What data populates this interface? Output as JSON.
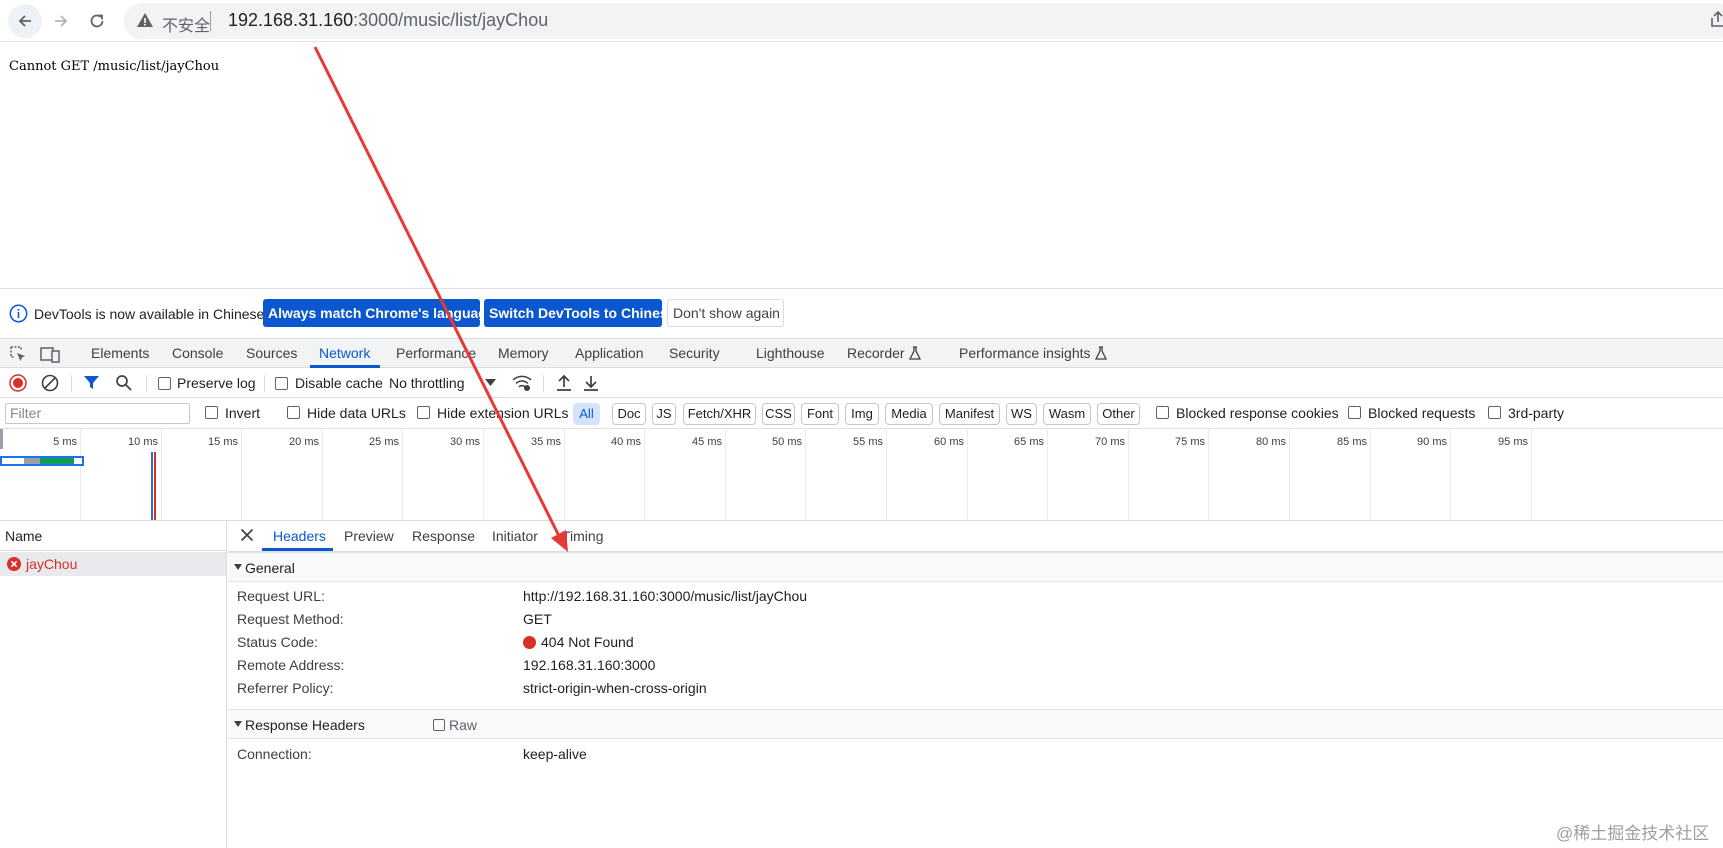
{
  "browser": {
    "insecure_label": "不安全",
    "url_host": "192.168.31.160",
    "url_rest": ":3000/music/list/jayChou"
  },
  "page": {
    "message": "Cannot GET /music/list/jayChou"
  },
  "infobar": {
    "text": "DevTools is now available in Chinese!",
    "btn_match": "Always match Chrome's language",
    "btn_switch": "Switch DevTools to Chinese",
    "btn_dismiss": "Don't show again"
  },
  "devtools": {
    "tabs": [
      "Elements",
      "Console",
      "Sources",
      "Network",
      "Performance",
      "Memory",
      "Application",
      "Security",
      "Lighthouse",
      "Recorder",
      "Performance insights"
    ],
    "active_tab": "Network"
  },
  "network_toolbar": {
    "preserve_log": "Preserve log",
    "disable_cache": "Disable cache",
    "throttling": "No throttling"
  },
  "filter_bar": {
    "placeholder": "Filter",
    "invert": "Invert",
    "hide_data_urls": "Hide data URLs",
    "hide_extension_urls": "Hide extension URLs",
    "types": [
      "All",
      "Doc",
      "JS",
      "Fetch/XHR",
      "CSS",
      "Font",
      "Img",
      "Media",
      "Manifest",
      "WS",
      "Wasm",
      "Other"
    ],
    "active_type": "All",
    "blocked_response_cookies": "Blocked response cookies",
    "blocked_requests": "Blocked requests",
    "third_party": "3rd-party"
  },
  "timeline": {
    "ticks": [
      "5 ms",
      "10 ms",
      "15 ms",
      "20 ms",
      "25 ms",
      "30 ms",
      "35 ms",
      "40 ms",
      "45 ms",
      "50 ms",
      "55 ms",
      "60 ms",
      "65 ms",
      "70 ms",
      "75 ms",
      "80 ms",
      "85 ms",
      "90 ms",
      "95 ms"
    ]
  },
  "requests": {
    "header": "Name",
    "items": [
      {
        "name": "jayChou",
        "status": "error"
      }
    ]
  },
  "details": {
    "tabs": [
      "Headers",
      "Preview",
      "Response",
      "Initiator",
      "Timing"
    ],
    "active_tab": "Headers",
    "general": {
      "title": "General",
      "rows": [
        {
          "key": "Request URL:",
          "value": "http://192.168.31.160:3000/music/list/jayChou"
        },
        {
          "key": "Request Method:",
          "value": "GET"
        },
        {
          "key": "Status Code:",
          "value": "404 Not Found"
        },
        {
          "key": "Remote Address:",
          "value": "192.168.31.160:3000"
        },
        {
          "key": "Referrer Policy:",
          "value": "strict-origin-when-cross-origin"
        }
      ]
    },
    "response_headers": {
      "title": "Response Headers",
      "raw_label": "Raw",
      "rows": [
        {
          "key": "Connection:",
          "value": "keep-alive"
        }
      ]
    }
  },
  "watermark": "@稀土掘金技术社区",
  "colors": {
    "accent": "#0b57d0",
    "error": "#d93025",
    "annotation_arrow": "#e53935"
  }
}
